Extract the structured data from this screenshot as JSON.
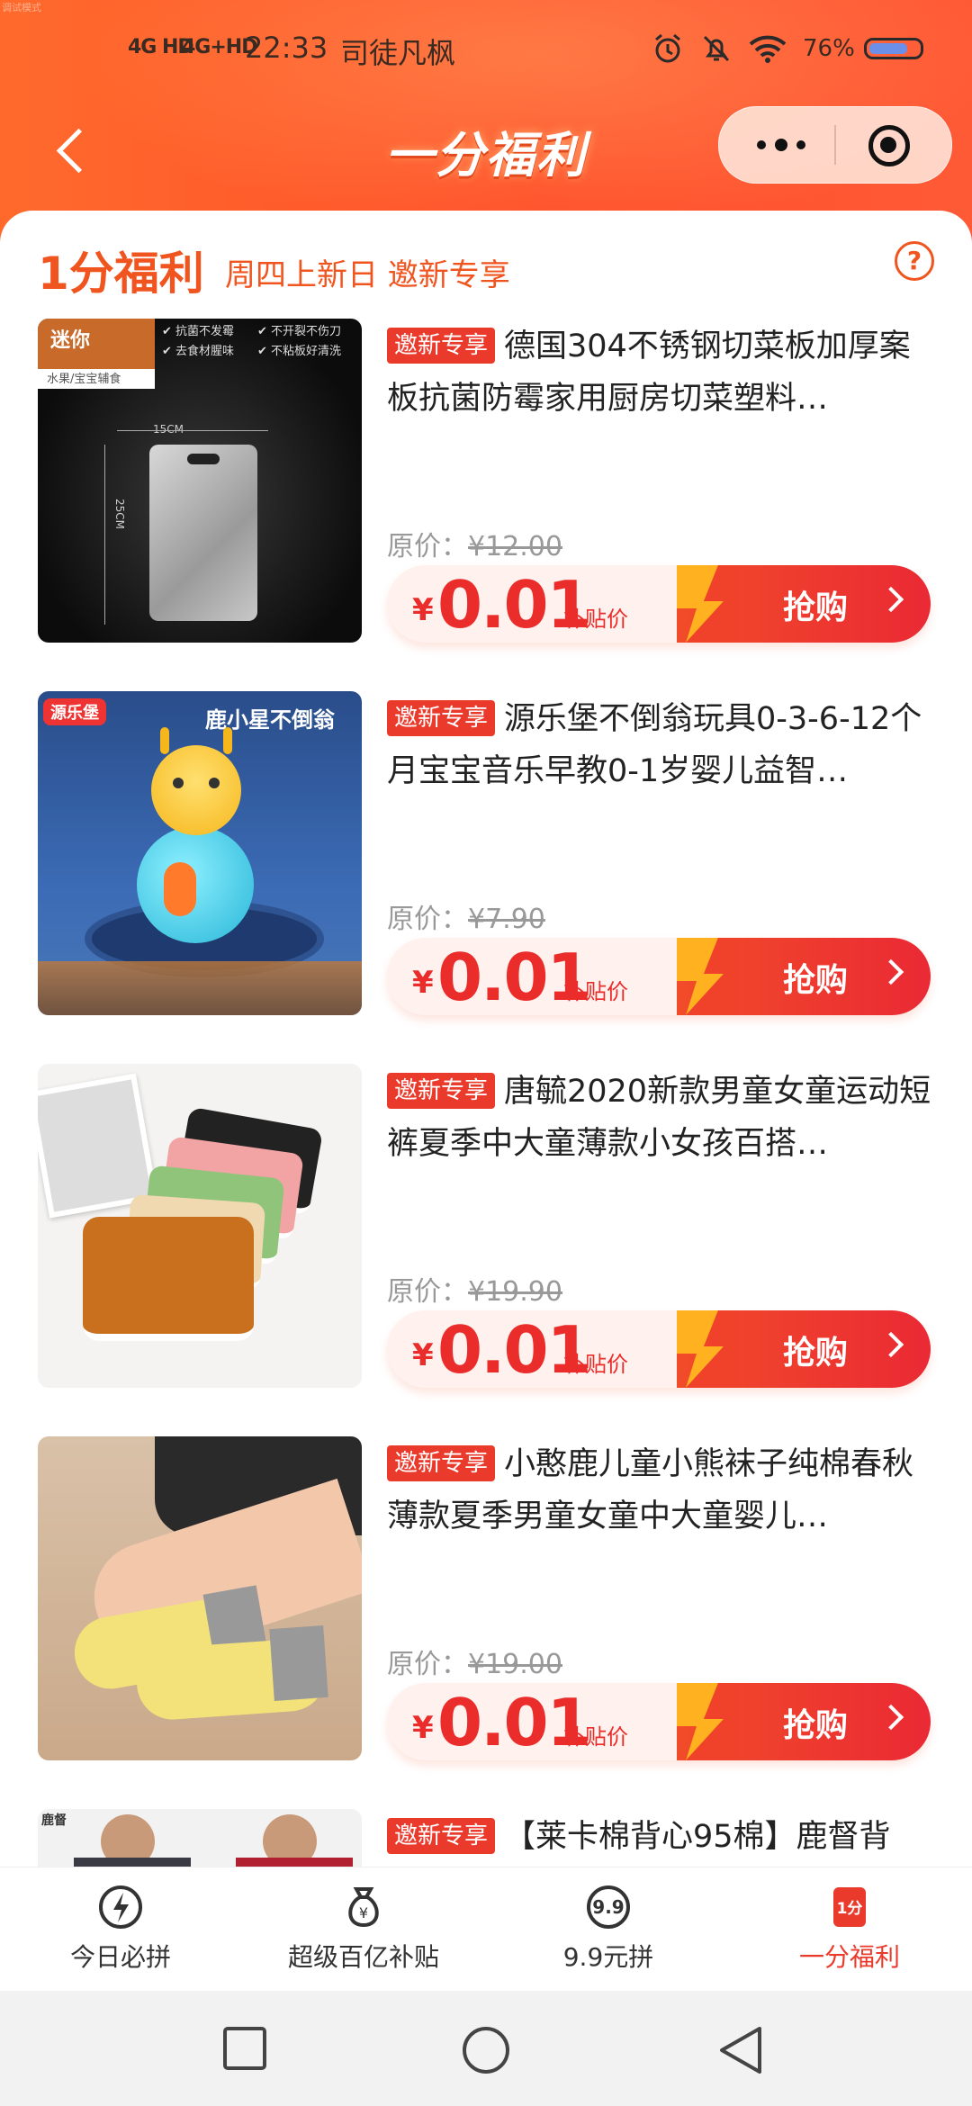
{
  "corner_tag": "调试模式",
  "status_bar": {
    "network1": "4G HD",
    "network2": "4G+HD",
    "time": "22:33",
    "user": "司徒凡枫",
    "battery": "76%"
  },
  "nav": {
    "title": "一分福利"
  },
  "section": {
    "title": "1分福利",
    "subtitle": "周四上新日 邀新专享",
    "help": "?"
  },
  "products": [
    {
      "tag": "邀新专享",
      "title": "德国304不锈钢切菜板加厚案板抗菌防霉家用厨房切菜塑料…",
      "orig_label": "原价：",
      "orig_price": "¥12.00",
      "price_symbol": "¥",
      "price": "0.01",
      "price_note": "补贴价",
      "buy": "抢购",
      "img": {
        "mini": "迷你",
        "mini_sub": "水果/宝宝辅食",
        "f1": "✔ 抗菌不发霉",
        "f2": "✔ 不开裂不伤刀",
        "f3": "✔ 去食材腥味",
        "f4": "✔ 不粘板好清洗",
        "w": "15CM",
        "h": "25CM"
      }
    },
    {
      "tag": "邀新专享",
      "title": "源乐堡不倒翁玩具0-3-6-12个月宝宝音乐早教0-1岁婴儿益智…",
      "orig_label": "原价：",
      "orig_price": "¥7.90",
      "price_symbol": "¥",
      "price": "0.01",
      "price_note": "补贴价",
      "buy": "抢购",
      "img": {
        "brand": "源乐堡",
        "caption": "鹿小星不倒翁"
      }
    },
    {
      "tag": "邀新专享",
      "title": "唐毓2020新款男童女童运动短裤夏季中大童薄款小女孩百搭…",
      "orig_label": "原价：",
      "orig_price": "¥19.90",
      "price_symbol": "¥",
      "price": "0.01",
      "price_note": "补贴价",
      "buy": "抢购"
    },
    {
      "tag": "邀新专享",
      "title": "小憨鹿儿童小熊袜子纯棉春秋薄款夏季男童女童中大童婴儿…",
      "orig_label": "原价：",
      "orig_price": "¥19.00",
      "price_symbol": "¥",
      "price": "0.01",
      "price_note": "补贴价",
      "buy": "抢购"
    },
    {
      "tag": "邀新专享",
      "title": "【莱卡棉背心95棉】鹿督背",
      "img": {
        "brand": "鹿督"
      }
    }
  ],
  "tabs": [
    {
      "label": "今日必拼",
      "icon": "lightning-icon"
    },
    {
      "label": "超级百亿补贴",
      "icon": "money-bag-icon"
    },
    {
      "label": "9.9元拼",
      "icon": "nine-nine-icon",
      "icon_text": "9.9"
    },
    {
      "label": "一分福利",
      "icon": "one-cent-icon",
      "icon_text": "1分"
    }
  ],
  "colors": {
    "brand": "#f0541f",
    "price_red": "#ea2d2a",
    "tab_active": "#ea3a2c"
  }
}
